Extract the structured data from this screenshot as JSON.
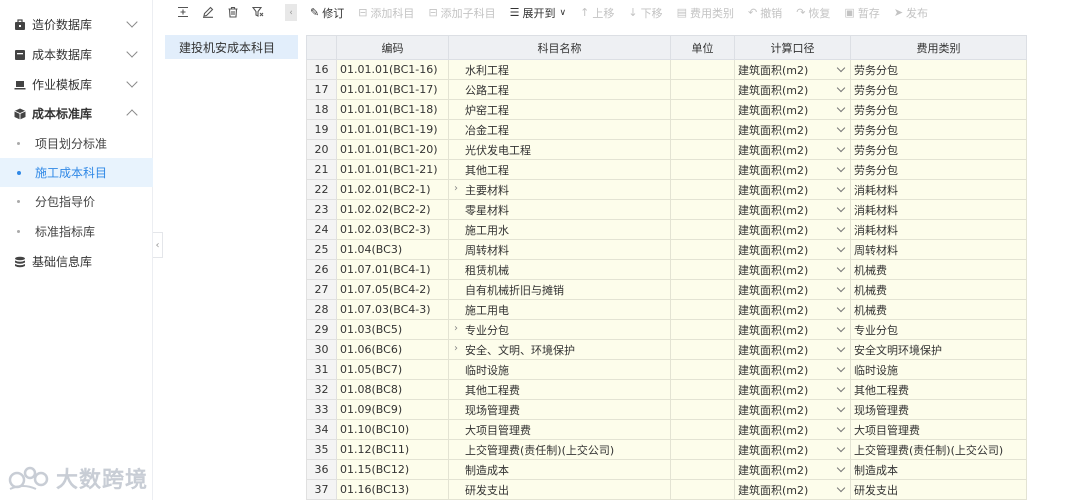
{
  "sidebar": {
    "items": [
      {
        "label": "造价数据库",
        "icon": "database-icon",
        "expanded": false
      },
      {
        "label": "成本数据库",
        "icon": "archive-icon",
        "expanded": false
      },
      {
        "label": "作业模板库",
        "icon": "laptop-icon",
        "expanded": false
      },
      {
        "label": "成本标准库",
        "icon": "cube-icon",
        "expanded": true
      },
      {
        "label": "基础信息库",
        "icon": "stack-icon",
        "expanded": false
      }
    ],
    "subitems": [
      {
        "label": "项目划分标准",
        "active": false
      },
      {
        "label": "施工成本科目",
        "active": true
      },
      {
        "label": "分包指导价",
        "active": false
      },
      {
        "label": "标准指标库",
        "active": false
      }
    ]
  },
  "tree": {
    "node": "建投机安成本科目"
  },
  "toolbar": {
    "buttons": [
      {
        "label": "修订",
        "glyph": "✎",
        "enabled": true
      },
      {
        "label": "添加科目",
        "glyph": "⊟",
        "enabled": false
      },
      {
        "label": "添加子科目",
        "glyph": "⊟",
        "enabled": false
      },
      {
        "label": "展开到",
        "glyph": "☰",
        "enabled": true,
        "dropdown": true
      },
      {
        "label": "上移",
        "glyph": "↑",
        "enabled": false
      },
      {
        "label": "下移",
        "glyph": "↓",
        "enabled": false
      },
      {
        "label": "费用类别",
        "glyph": "▤",
        "enabled": false
      },
      {
        "label": "撤销",
        "glyph": "↶",
        "enabled": false
      },
      {
        "label": "恢复",
        "glyph": "↷",
        "enabled": false
      },
      {
        "label": "暂存",
        "glyph": "▣",
        "enabled": false
      },
      {
        "label": "发布",
        "glyph": "➤",
        "enabled": false
      }
    ]
  },
  "table": {
    "columns": [
      "",
      "编码",
      "科目名称",
      "单位",
      "计算口径",
      "费用类别"
    ],
    "rows": [
      {
        "idx": "16",
        "code": "01.01.01(BC1-16)",
        "name": "水利工程",
        "expand": false,
        "unit": "",
        "basis": "建筑面积(m2)",
        "category": "劳务分包"
      },
      {
        "idx": "17",
        "code": "01.01.01(BC1-17)",
        "name": "公路工程",
        "expand": false,
        "unit": "",
        "basis": "建筑面积(m2)",
        "category": "劳务分包"
      },
      {
        "idx": "18",
        "code": "01.01.01(BC1-18)",
        "name": "炉窑工程",
        "expand": false,
        "unit": "",
        "basis": "建筑面积(m2)",
        "category": "劳务分包"
      },
      {
        "idx": "19",
        "code": "01.01.01(BC1-19)",
        "name": "冶金工程",
        "expand": false,
        "unit": "",
        "basis": "建筑面积(m2)",
        "category": "劳务分包"
      },
      {
        "idx": "20",
        "code": "01.01.01(BC1-20)",
        "name": "光伏发电工程",
        "expand": false,
        "unit": "",
        "basis": "建筑面积(m2)",
        "category": "劳务分包"
      },
      {
        "idx": "21",
        "code": "01.01.01(BC1-21)",
        "name": "其他工程",
        "expand": false,
        "unit": "",
        "basis": "建筑面积(m2)",
        "category": "劳务分包"
      },
      {
        "idx": "22",
        "code": "01.02.01(BC2-1)",
        "name": "主要材料",
        "expand": true,
        "unit": "",
        "basis": "建筑面积(m2)",
        "category": "消耗材料"
      },
      {
        "idx": "23",
        "code": "01.02.02(BC2-2)",
        "name": "零星材料",
        "expand": false,
        "unit": "",
        "basis": "建筑面积(m2)",
        "category": "消耗材料"
      },
      {
        "idx": "24",
        "code": "01.02.03(BC2-3)",
        "name": "施工用水",
        "expand": false,
        "unit": "",
        "basis": "建筑面积(m2)",
        "category": "消耗材料"
      },
      {
        "idx": "25",
        "code": "01.04(BC3)",
        "name": "周转材料",
        "expand": false,
        "unit": "",
        "basis": "建筑面积(m2)",
        "category": "周转材料"
      },
      {
        "idx": "26",
        "code": "01.07.01(BC4-1)",
        "name": "租赁机械",
        "expand": false,
        "unit": "",
        "basis": "建筑面积(m2)",
        "category": "机械费"
      },
      {
        "idx": "27",
        "code": "01.07.05(BC4-2)",
        "name": "自有机械折旧与摊销",
        "expand": false,
        "unit": "",
        "basis": "建筑面积(m2)",
        "category": "机械费"
      },
      {
        "idx": "28",
        "code": "01.07.03(BC4-3)",
        "name": "施工用电",
        "expand": false,
        "unit": "",
        "basis": "建筑面积(m2)",
        "category": "机械费"
      },
      {
        "idx": "29",
        "code": "01.03(BC5)",
        "name": "专业分包",
        "expand": true,
        "unit": "",
        "basis": "建筑面积(m2)",
        "category": "专业分包"
      },
      {
        "idx": "30",
        "code": "01.06(BC6)",
        "name": "安全、文明、环境保护",
        "expand": true,
        "unit": "",
        "basis": "建筑面积(m2)",
        "category": "安全文明环境保护"
      },
      {
        "idx": "31",
        "code": "01.05(BC7)",
        "name": "临时设施",
        "expand": false,
        "unit": "",
        "basis": "建筑面积(m2)",
        "category": "临时设施"
      },
      {
        "idx": "32",
        "code": "01.08(BC8)",
        "name": "其他工程费",
        "expand": false,
        "unit": "",
        "basis": "建筑面积(m2)",
        "category": "其他工程费"
      },
      {
        "idx": "33",
        "code": "01.09(BC9)",
        "name": "现场管理费",
        "expand": false,
        "unit": "",
        "basis": "建筑面积(m2)",
        "category": "现场管理费"
      },
      {
        "idx": "34",
        "code": "01.10(BC10)",
        "name": "大项目管理费",
        "expand": false,
        "unit": "",
        "basis": "建筑面积(m2)",
        "category": "大项目管理费"
      },
      {
        "idx": "35",
        "code": "01.12(BC11)",
        "name": "上交管理费(责任制)(上交公司)",
        "expand": false,
        "unit": "",
        "basis": "建筑面积(m2)",
        "category": "上交管理费(责任制)(上交公司)"
      },
      {
        "idx": "36",
        "code": "01.15(BC12)",
        "name": "制造成本",
        "expand": false,
        "unit": "",
        "basis": "建筑面积(m2)",
        "category": "制造成本"
      },
      {
        "idx": "37",
        "code": "01.16(BC13)",
        "name": "研发支出",
        "expand": false,
        "unit": "",
        "basis": "建筑面积(m2)",
        "category": "研发支出"
      }
    ]
  },
  "watermark": {
    "text": "大数跨境"
  }
}
